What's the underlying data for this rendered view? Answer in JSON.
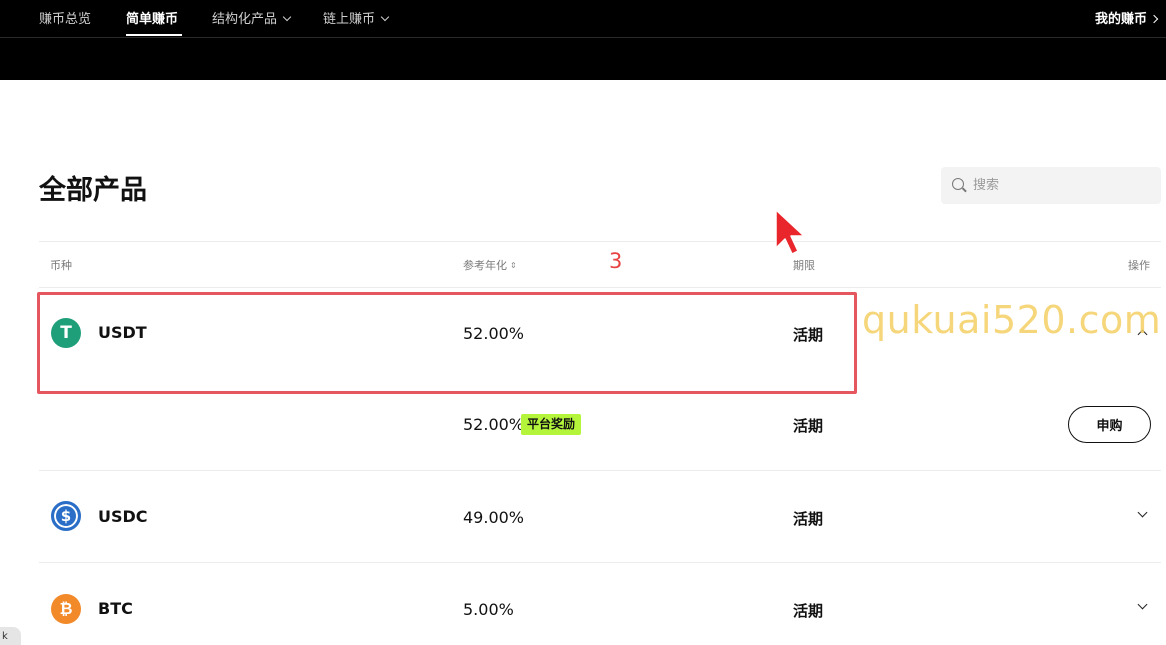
{
  "nav": {
    "items": [
      {
        "label": "赚币总览"
      },
      {
        "label": "简单赚币",
        "active": true
      },
      {
        "label": "结构化产品"
      },
      {
        "label": "链上赚币"
      }
    ],
    "my_earn": "我的赚币"
  },
  "title": "全部产品",
  "search": {
    "placeholder": "搜索"
  },
  "table": {
    "headers": {
      "coin": "币种",
      "apr": "参考年化",
      "term": "期限",
      "action": "操作"
    },
    "rows": [
      {
        "coin": "USDT",
        "rate": "52.00%",
        "term": "活期",
        "expanded": true,
        "sub": {
          "rate": "52.00%",
          "badge": "平台奖励",
          "term": "活期",
          "action": "申购"
        }
      },
      {
        "coin": "USDC",
        "rate": "49.00%",
        "term": "活期"
      },
      {
        "coin": "BTC",
        "rate": "5.00%",
        "term": "活期"
      }
    ]
  },
  "icons": {
    "usdt": "T",
    "usdc": "$",
    "btc": "₿"
  },
  "colors": {
    "usdt": "#1f9f79",
    "usdc": "#2a6ec8",
    "btc": "#f28a2a",
    "badge": "#b4f53c",
    "highlight": "#e5565e"
  },
  "annotation": {
    "number": "3"
  },
  "watermark": "qukuai520.com",
  "corner_label": "k"
}
